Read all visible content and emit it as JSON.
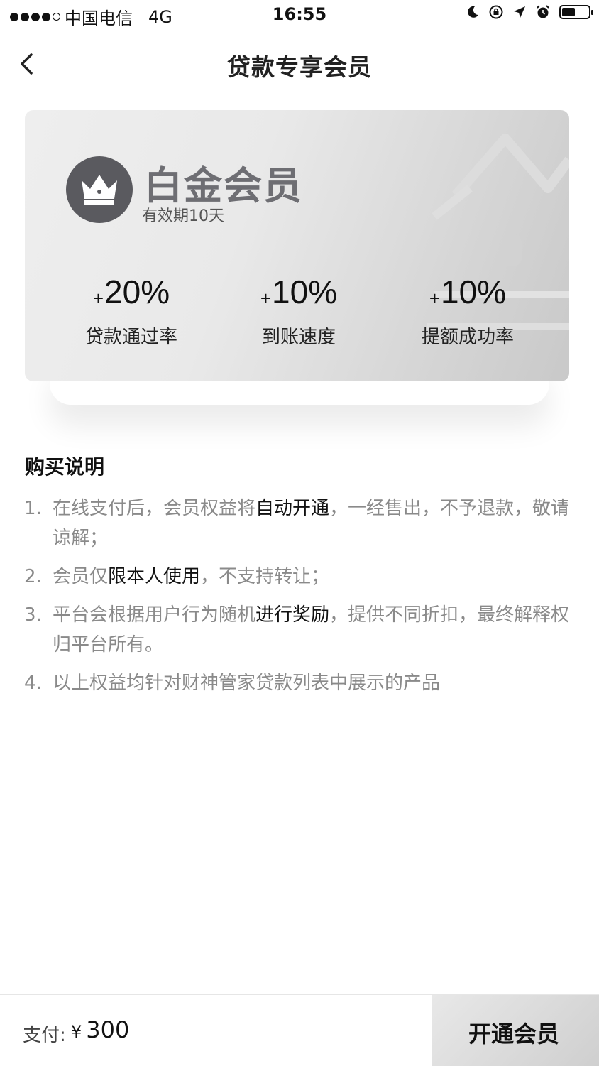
{
  "status_bar": {
    "carrier": "中国电信",
    "network": "4G",
    "time": "16:55"
  },
  "nav": {
    "title": "贷款专享会员",
    "back_icon": "chevron-left-icon"
  },
  "card": {
    "tier_name": "白金会员",
    "validity": "有效期10天",
    "icon": "crown-icon",
    "stats": [
      {
        "plus": "+",
        "value": "20%",
        "label": "贷款通过率"
      },
      {
        "plus": "+",
        "value": "10%",
        "label": "到账速度"
      },
      {
        "plus": "+",
        "value": "10%",
        "label": "提额成功率"
      }
    ]
  },
  "instructions": {
    "title": "购买说明",
    "items": [
      {
        "num": "1.",
        "pre": "在线支付后，会员权益将",
        "hl": "自动开通",
        "post": "，一经售出，不予退款，敬请谅解；"
      },
      {
        "num": "2.",
        "pre": "会员仅",
        "hl": "限本人使用",
        "post": "，不支持转让；"
      },
      {
        "num": "3.",
        "pre": "平台会根据用户行为随机",
        "hl": "进行奖励",
        "post": "，提供不同折扣，最终解释权归平台所有。"
      },
      {
        "num": "4.",
        "pre": "以上权益均针对财神管家贷款列表中展示的产品",
        "hl": "",
        "post": ""
      }
    ]
  },
  "footer": {
    "pay_label": "支付:",
    "currency": "¥",
    "amount": "300",
    "button_label": "开通会员"
  }
}
